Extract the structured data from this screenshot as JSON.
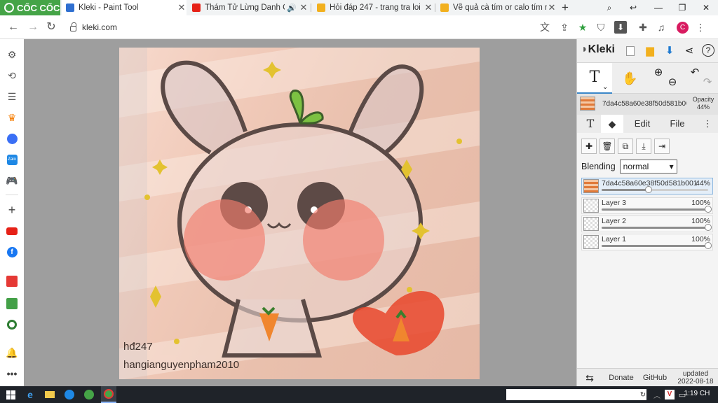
{
  "browser": {
    "brand": "CỐC CỐC",
    "tabs": [
      {
        "title": "Kleki - Paint Tool",
        "active": true,
        "favicon_color": "#2f6fd0"
      },
      {
        "title": "Thám Tử Lừng Danh Conan",
        "active": false,
        "favicon_color": "#e62117",
        "audio": true
      },
      {
        "title": "Hỏi đáp 247 - trang tra loi",
        "active": false,
        "favicon_color": "#f2b01e"
      },
      {
        "title": "Vẽ quả cà tím or calo tím ng",
        "active": false,
        "favicon_color": "#f2b01e"
      }
    ],
    "url": "kleki.com",
    "avatar_letter": "C",
    "icons": {
      "back": "back-arrow-icon",
      "forward": "forward-arrow-icon",
      "reload": "reload-icon",
      "translate": "translate-icon",
      "share": "share-icon",
      "bookmark": "star-icon",
      "shield": "shield-icon",
      "download": "download-icon",
      "extensions": "puzzle-icon"
    }
  },
  "sidebar": {
    "items": [
      "settings",
      "history",
      "notes",
      "shopping",
      "messenger",
      "zalo",
      "games",
      "add",
      "youtube",
      "facebook",
      "calendar",
      "coupon",
      "maps",
      "notifications",
      "more"
    ]
  },
  "canvas": {
    "watermark_line1": "hđ247",
    "watermark_line2": "hangianguyenpham2010"
  },
  "panel": {
    "logo": "Kleki",
    "current_layer": {
      "name": "7da4c58a60e38f50d581b00",
      "opacity_label": "Opacity",
      "opacity_value": "44%"
    },
    "tabs": {
      "text_icon": "T",
      "edit": "Edit",
      "file": "File"
    },
    "blending_label": "Blending",
    "blending_value": "normal",
    "layers": [
      {
        "name": "7da4c58a60e38f50d581b001",
        "opacity": "44%",
        "level": 0.44,
        "active": true,
        "thumb": "img"
      },
      {
        "name": "Layer 3",
        "opacity": "100%",
        "level": 1.0,
        "active": false,
        "thumb": "chk"
      },
      {
        "name": "Layer 2",
        "opacity": "100%",
        "level": 1.0,
        "active": false,
        "thumb": "chk"
      },
      {
        "name": "Layer 1",
        "opacity": "100%",
        "level": 1.0,
        "active": false,
        "thumb": "chk"
      }
    ],
    "footer": {
      "donate": "Donate",
      "github": "GitHub",
      "updated_label": "updated",
      "updated_date": "2022-08-18"
    }
  },
  "taskbar": {
    "time": "1:19 CH"
  }
}
